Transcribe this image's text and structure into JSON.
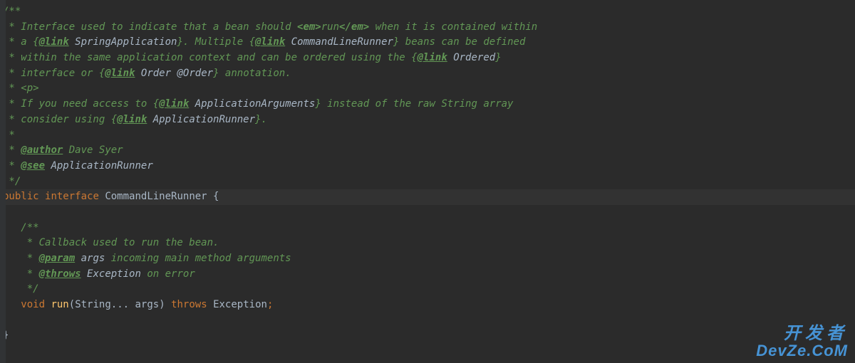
{
  "code": {
    "l1": "/**",
    "l2a": " * Interface used to indicate that a bean should ",
    "l2em1": "<em>",
    "l2run": "run",
    "l2em2": "</em>",
    "l2b": " when it is contained within",
    "l3a": " * a {",
    "l3link": "@link",
    "l3sp": " ",
    "l3ref": "SpringApplication",
    "l3b": "}. Multiple {",
    "l3link2": "@link",
    "l3sp2": " ",
    "l3ref2": "CommandLineRunner",
    "l3c": "} beans can be defined",
    "l4a": " * within the same application context and can be ordered using the {",
    "l4link": "@link",
    "l4sp": " ",
    "l4ref": "Ordered",
    "l4b": "}",
    "l5a": " * interface or {",
    "l5link": "@link",
    "l5sp": " ",
    "l5ref": "Order",
    "l5sp2": " ",
    "l5ref2": "@Order",
    "l5b": "} annotation.",
    "l6": " * <p>",
    "l7a": " * If you need access to {",
    "l7link": "@link",
    "l7sp": " ",
    "l7ref": "ApplicationArguments",
    "l7b": "} instead of the raw String array",
    "l8a": " * consider using {",
    "l8link": "@link",
    "l8sp": " ",
    "l8ref": "ApplicationRunner",
    "l8b": "}.",
    "l9": " *",
    "l10a": " * ",
    "l10tag": "@author",
    "l10b": " Dave Syer",
    "l11a": " * ",
    "l11tag": "@see",
    "l11sp": " ",
    "l11ref": "ApplicationRunner",
    "l12": " */",
    "l13kw1": "public",
    "l13sp1": " ",
    "l13kw2": "interface",
    "l13sp2": " ",
    "l13name": "CommandLineRunner",
    "l13sp3": " ",
    "l13brace": "{",
    "l14": "",
    "l15": "   /**",
    "l16": "    * Callback used to run the bean.",
    "l17a": "    * ",
    "l17tag": "@param",
    "l17sp": " ",
    "l17p": "args",
    "l17b": " incoming main method arguments",
    "l18a": "    * ",
    "l18tag": "@throws",
    "l18sp": " ",
    "l18ref": "Exception",
    "l18b": " on error",
    "l19": "    */",
    "l20ind": "   ",
    "l20kw": "void",
    "l20sp": " ",
    "l20m": "run",
    "l20p1": "(",
    "l20t": "String",
    "l20dots": "... ",
    "l20a": "args",
    "l20p2": ") ",
    "l20th": "throws",
    "l20sp2": " ",
    "l20ex": "Exception",
    "l20semi": ";",
    "l21": "",
    "l22": "}"
  },
  "watermark": {
    "line1": "开发者",
    "line2": "DevZe.CoM"
  }
}
